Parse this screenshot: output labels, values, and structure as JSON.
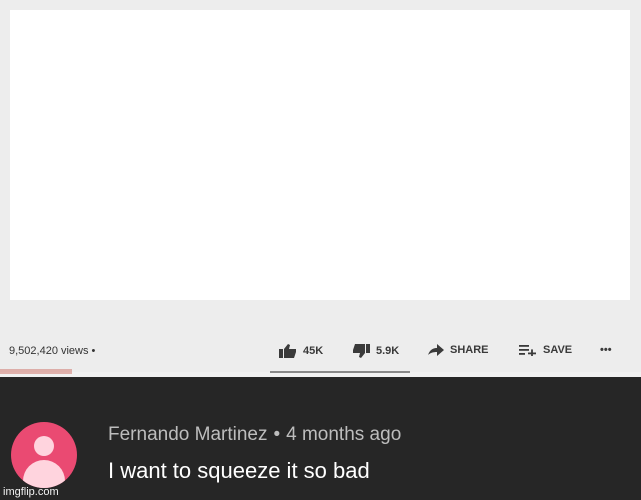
{
  "video": {
    "views_text": "9,502,420 views •"
  },
  "actions": {
    "like_count": "45K",
    "dislike_count": "5.9K",
    "share_label": "SHARE",
    "save_label": "SAVE",
    "more_label": "•••"
  },
  "comment": {
    "author": "Fernando Martinez",
    "separator": "•",
    "time": "4 months ago",
    "text": "I want to squeeze it so bad"
  },
  "watermark": "imgflip.com",
  "colors": {
    "avatar_bg": "#ea4a72",
    "comment_bg": "#262626",
    "page_bg": "#ededed"
  }
}
